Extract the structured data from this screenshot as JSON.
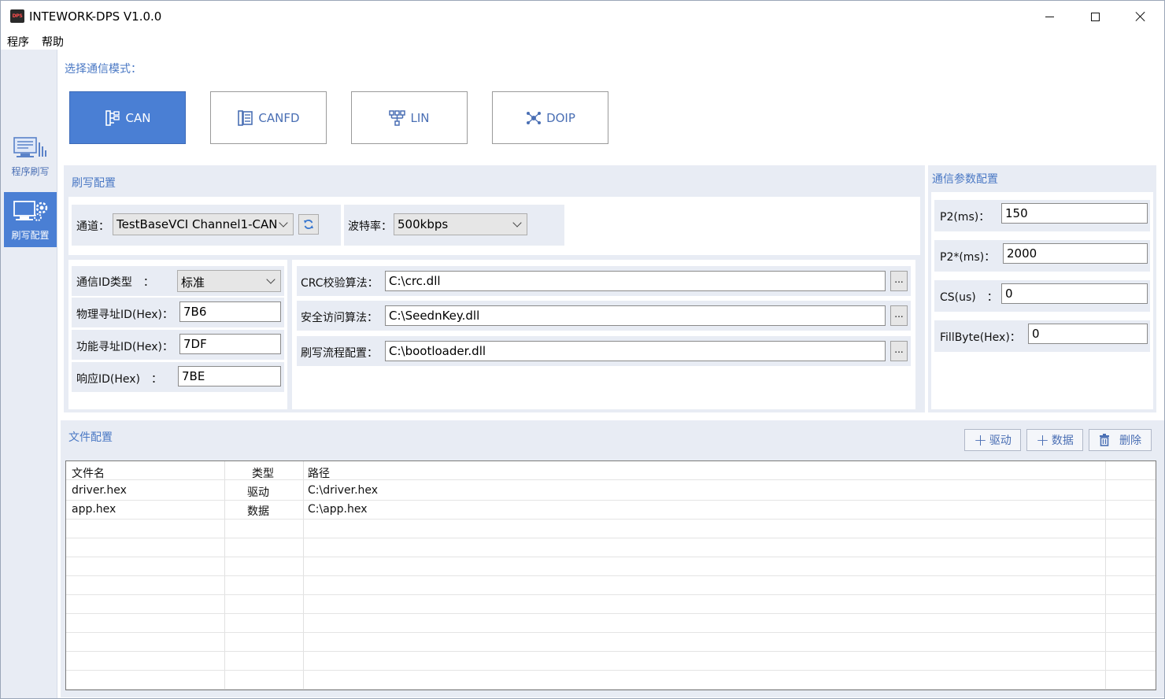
{
  "window": {
    "title": "INTEWORK-DPS V1.0.0",
    "app_icon_text": "DPS"
  },
  "menu": [
    "程序",
    "帮助"
  ],
  "sidebar": {
    "items": [
      {
        "label": "程序刷写",
        "icon": "monitor-flash-icon",
        "active": false
      },
      {
        "label": "刷写配置",
        "icon": "monitor-gear-icon",
        "active": true
      }
    ]
  },
  "mode_select": {
    "label": "选择通信模式：",
    "modes": [
      {
        "label": "CAN",
        "icon": "tree-icon",
        "active": true
      },
      {
        "label": "CANFD",
        "icon": "document-list-icon",
        "active": false
      },
      {
        "label": "LIN",
        "icon": "network-icon",
        "active": false
      },
      {
        "label": "DOIP",
        "icon": "nodes-icon",
        "active": false
      }
    ]
  },
  "flash_config": {
    "title": "刷写配置",
    "channel_label": "通道：",
    "channel_value": "TestBaseVCI Channel1-CAN",
    "baud_label": "波特率：",
    "baud_value": "500kbps",
    "id_type_label": "通信ID类型　：",
    "id_type_value": "标准",
    "phys_id_label": "物理寻址ID(Hex)：",
    "phys_id_value": "7B6",
    "func_id_label": "功能寻址ID(Hex)：",
    "func_id_value": "7DF",
    "resp_id_label": "响应ID(Hex)　：",
    "resp_id_value": "7BE",
    "crc_label": "CRC校验算法：",
    "crc_value": "C:\\crc.dll",
    "security_label": "安全访问算法：",
    "security_value": "C:\\SeednKey.dll",
    "flow_label": "刷写流程配置：",
    "flow_value": "C:\\bootloader.dll",
    "browse_label": "..."
  },
  "comm_params": {
    "title": "通信参数配置",
    "p2_label": "P2(ms)：",
    "p2_value": "150",
    "p2star_label": "P2*(ms)：",
    "p2star_value": "2000",
    "cs_label": "CS(us)　：",
    "cs_value": "0",
    "fill_label": "FillByte(Hex)：",
    "fill_value": "0"
  },
  "file_config": {
    "title": "文件配置",
    "add_driver": "驱动",
    "add_data": "数据",
    "delete": "删除",
    "columns": [
      "文件名",
      "类型",
      "路径"
    ],
    "rows": [
      {
        "name": "driver.hex",
        "type": "驱动",
        "path": "C:\\driver.hex"
      },
      {
        "name": "app.hex",
        "type": "数据",
        "path": "C:\\app.hex"
      }
    ]
  }
}
